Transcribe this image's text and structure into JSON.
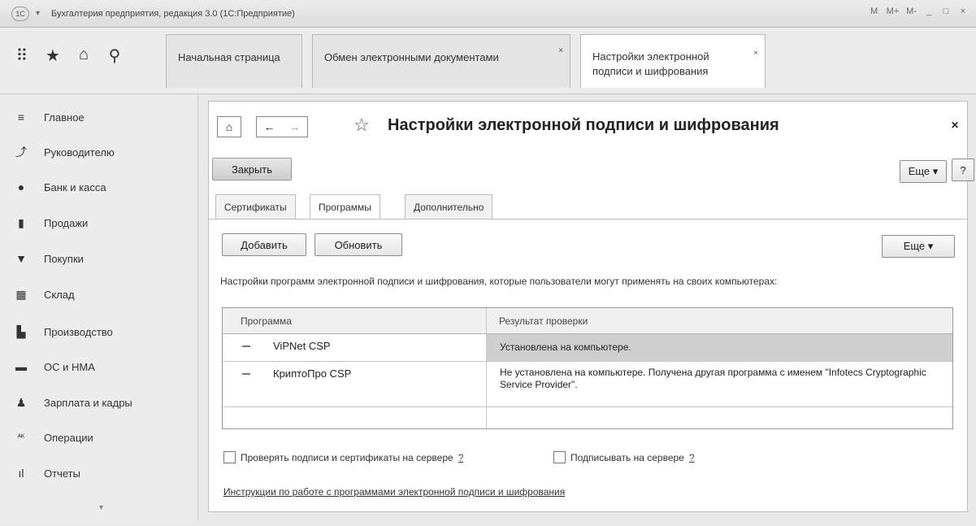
{
  "window": {
    "title": "Бухгалтерия предприятия, редакция 3.0 (1С:Предприятие)",
    "controls": [
      "M",
      "M+",
      "M-",
      "_",
      "□",
      "×"
    ]
  },
  "open_tabs": [
    {
      "label": "Начальная страница"
    },
    {
      "label": "Обмен электронными документами",
      "close": "×"
    },
    {
      "label_line1": "Настройки электронной",
      "label_line2": "подписи и шифрования",
      "close": "×"
    }
  ],
  "sidebar": {
    "items": [
      {
        "label": "Главное",
        "icon": "≡"
      },
      {
        "label": "Руководителю",
        "icon": "⤴"
      },
      {
        "label": "Банк и касса",
        "icon": "●"
      },
      {
        "label": "Продажи",
        "icon": "▮"
      },
      {
        "label": "Покупки",
        "icon": "▼"
      },
      {
        "label": "Склад",
        "icon": "▦"
      },
      {
        "label": "Производство",
        "icon": "▙"
      },
      {
        "label": "ОС и НМА",
        "icon": "▬"
      },
      {
        "label": "Зарплата и кадры",
        "icon": "♟"
      },
      {
        "label": "Операции",
        "icon": "ᴬᴷ"
      },
      {
        "label": "Отчеты",
        "icon": "ıl"
      }
    ]
  },
  "form": {
    "title": "Настройки электронной подписи и шифрования",
    "close_button": "Закрыть",
    "more_button": "Еще ▾",
    "help_button": "?",
    "tabs": [
      "Сертификаты",
      "Программы",
      "Дополнительно"
    ],
    "add_button": "Добавить",
    "refresh_button": "Обновить",
    "table_more_button": "Еще ▾",
    "description": "Настройки программ электронной подписи и шифрования, которые пользователи могут применять на своих компьютерах:",
    "table": {
      "headers": [
        "Программа",
        "Результат проверки"
      ],
      "rows": [
        {
          "program": "ViPNet CSP",
          "result": "Установлена на компьютере."
        },
        {
          "program": "КриптоПро CSP",
          "result": "Не установлена на компьютере. Получена другая программа с именем \"Infotecs Cryptographic Service Provider\"."
        }
      ]
    },
    "check_server": "Проверять подписи и сертификаты на сервере",
    "sign_server": "Подписывать на сервере",
    "help_mark": "?",
    "instructions_link": "Инструкции по работе с программами электронной подписи и шифрования"
  }
}
